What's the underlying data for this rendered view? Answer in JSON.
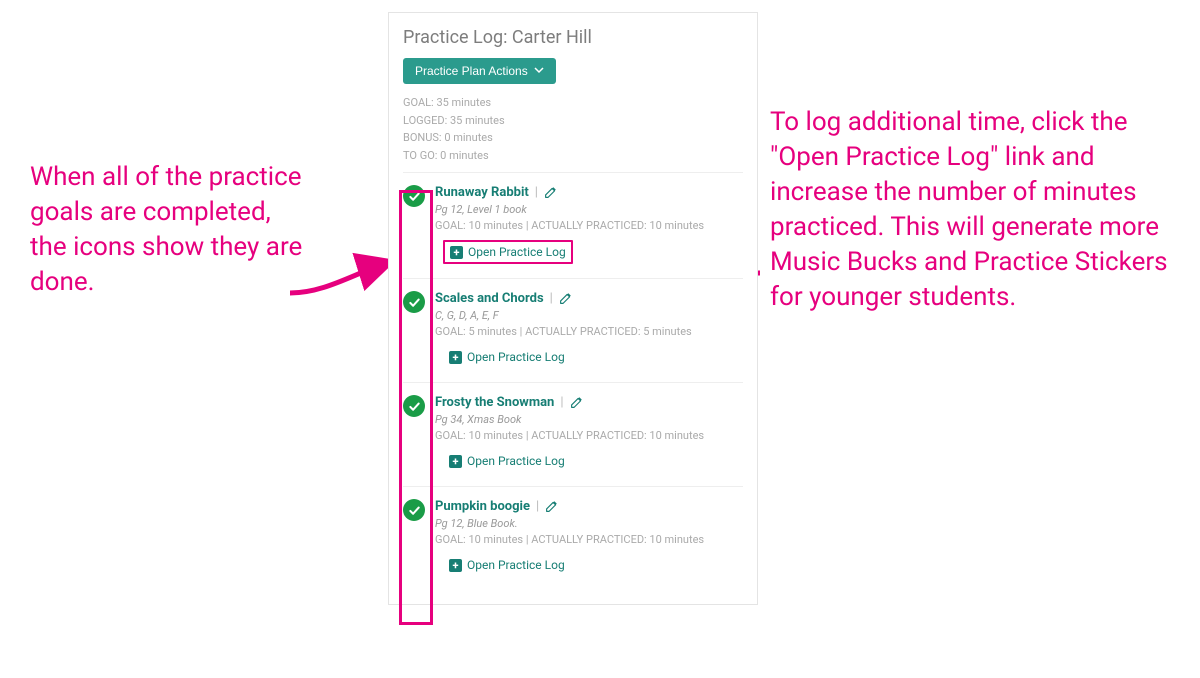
{
  "annotations": {
    "left": "When all of the practice goals are completed, the icons show they are done.",
    "right": "To log additional time, click the \"Open Practice Log\" link and increase the number of minutes practiced. This will generate more Music Bucks and Practice Stickers for younger students."
  },
  "panel": {
    "title": "Practice Log: Carter Hill",
    "actions_label": "Practice Plan Actions",
    "summary": {
      "goal": "GOAL: 35 minutes",
      "logged": "LOGGED: 35 minutes",
      "bonus": "BONUS: 0 minutes",
      "togo": "TO GO: 0 minutes"
    },
    "open_log_label": "Open Practice Log",
    "items": [
      {
        "title": "Runaway Rabbit",
        "sub": "Pg 12, Level 1 book",
        "meta": "GOAL: 10 minutes | ACTUALLY PRACTICED: 10 minutes",
        "highlight": true
      },
      {
        "title": "Scales and Chords",
        "sub": "C, G, D, A, E, F",
        "meta": "GOAL: 5 minutes | ACTUALLY PRACTICED: 5 minutes",
        "highlight": false
      },
      {
        "title": "Frosty the Snowman",
        "sub": "Pg 34, Xmas Book",
        "meta": "GOAL: 10 minutes | ACTUALLY PRACTICED: 10 minutes",
        "highlight": false
      },
      {
        "title": "Pumpkin boogie",
        "sub": "Pg 12, Blue Book.",
        "meta": "GOAL: 10 minutes | ACTUALLY PRACTICED: 10 minutes",
        "highlight": false
      }
    ]
  }
}
